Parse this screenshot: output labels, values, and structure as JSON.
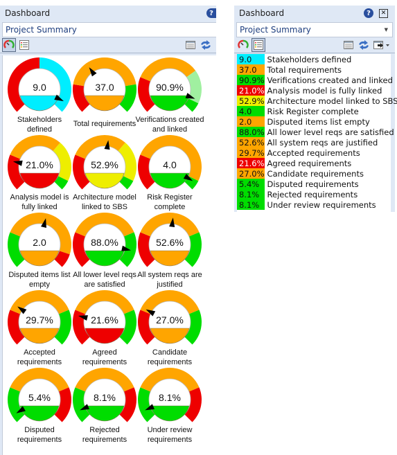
{
  "palette": {
    "red": "#ee0000",
    "orange": "#ffa500",
    "green": "#00dd00",
    "yellow": "#eeee00",
    "cyan": "#00eeff",
    "light_green": "#a0f0a0"
  },
  "left_panel": {
    "title": "Dashboard",
    "help_icon": "?",
    "view_selector": "Project Summary",
    "gauges": [
      {
        "value": 9.0,
        "display": "9.0",
        "label": "Stakeholders defined",
        "needle_fraction": 0.93,
        "fill_color": "cyan",
        "bands": [
          {
            "color": "red",
            "from": 0,
            "to": 0.5
          },
          {
            "color": "cyan",
            "from": 0.5,
            "to": 1
          }
        ]
      },
      {
        "value": 37.0,
        "display": "37.0",
        "label": "Total requirements",
        "needle_fraction": 0.37,
        "fill_color": "orange",
        "bands": [
          {
            "color": "red",
            "from": 0,
            "to": 0.2
          },
          {
            "color": "orange",
            "from": 0.2,
            "to": 0.8
          },
          {
            "color": "green",
            "from": 0.8,
            "to": 1
          }
        ]
      },
      {
        "value": 90.9,
        "display": "90.9%",
        "label": "Verifications created and linked",
        "needle_fraction": 0.909,
        "fill_color": "green",
        "bands": [
          {
            "color": "red",
            "from": 0,
            "to": 0.25
          },
          {
            "color": "orange",
            "from": 0.25,
            "to": 0.7
          },
          {
            "color": "light_green",
            "from": 0.7,
            "to": 0.93
          },
          {
            "color": "green",
            "from": 0.93,
            "to": 1
          }
        ]
      },
      {
        "value": 21.0,
        "display": "21.0%",
        "label": "Analysis model is fully linked",
        "needle_fraction": 0.21,
        "fill_color": "red",
        "bands": [
          {
            "color": "red",
            "from": 0,
            "to": 0.25
          },
          {
            "color": "orange",
            "from": 0.25,
            "to": 0.65
          },
          {
            "color": "yellow",
            "from": 0.65,
            "to": 0.93
          },
          {
            "color": "green",
            "from": 0.93,
            "to": 1
          }
        ]
      },
      {
        "value": 52.9,
        "display": "52.9%",
        "label": "Architecture model linked to SBS",
        "needle_fraction": 0.529,
        "fill_color": "yellow",
        "bands": [
          {
            "color": "red",
            "from": 0,
            "to": 0.25
          },
          {
            "color": "orange",
            "from": 0.25,
            "to": 0.65
          },
          {
            "color": "yellow",
            "from": 0.65,
            "to": 0.93
          },
          {
            "color": "green",
            "from": 0.93,
            "to": 1
          }
        ]
      },
      {
        "value": 4.0,
        "display": "4.0",
        "label": "Risk Register complete",
        "needle_fraction": 0.95,
        "fill_color": "green",
        "bands": [
          {
            "color": "red",
            "from": 0,
            "to": 0.25
          },
          {
            "color": "orange",
            "from": 0.25,
            "to": 0.93
          },
          {
            "color": "green",
            "from": 0.93,
            "to": 1
          }
        ]
      },
      {
        "value": 2.0,
        "display": "2.0",
        "label": "Disputed items list empty",
        "needle_fraction": 0.55,
        "fill_color": "orange",
        "bands": [
          {
            "color": "green",
            "from": 0,
            "to": 0.25
          },
          {
            "color": "orange",
            "from": 0.25,
            "to": 0.9
          },
          {
            "color": "red",
            "from": 0.9,
            "to": 1
          }
        ]
      },
      {
        "value": 88.0,
        "display": "88.0%",
        "label": "All lower level reqs are satisfied",
        "needle_fraction": 0.88,
        "fill_color": "green",
        "bands": [
          {
            "color": "red",
            "from": 0,
            "to": 0.25
          },
          {
            "color": "orange",
            "from": 0.25,
            "to": 0.75
          },
          {
            "color": "green",
            "from": 0.75,
            "to": 1
          }
        ]
      },
      {
        "value": 52.6,
        "display": "52.6%",
        "label": "All system reqs are justified",
        "needle_fraction": 0.526,
        "fill_color": "orange",
        "bands": [
          {
            "color": "red",
            "from": 0,
            "to": 0.25
          },
          {
            "color": "orange",
            "from": 0.25,
            "to": 0.75
          },
          {
            "color": "green",
            "from": 0.75,
            "to": 1
          }
        ]
      },
      {
        "value": 29.7,
        "display": "29.7%",
        "label": "Accepted requirements",
        "needle_fraction": 0.297,
        "fill_color": "orange",
        "bands": [
          {
            "color": "red",
            "from": 0,
            "to": 0.25
          },
          {
            "color": "orange",
            "from": 0.25,
            "to": 0.75
          },
          {
            "color": "green",
            "from": 0.75,
            "to": 1
          }
        ]
      },
      {
        "value": 21.6,
        "display": "21.6%",
        "label": "Agreed requirements",
        "needle_fraction": 0.216,
        "fill_color": "red",
        "bands": [
          {
            "color": "red",
            "from": 0,
            "to": 0.25
          },
          {
            "color": "orange",
            "from": 0.25,
            "to": 0.75
          },
          {
            "color": "green",
            "from": 0.75,
            "to": 1
          }
        ]
      },
      {
        "value": 27.0,
        "display": "27.0%",
        "label": "Candidate requirements",
        "needle_fraction": 0.27,
        "fill_color": "orange",
        "bands": [
          {
            "color": "red",
            "from": 0,
            "to": 0.25
          },
          {
            "color": "orange",
            "from": 0.25,
            "to": 0.75
          },
          {
            "color": "green",
            "from": 0.75,
            "to": 1
          }
        ]
      },
      {
        "value": 5.4,
        "display": "5.4%",
        "label": "Disputed requirements",
        "needle_fraction": 0.054,
        "fill_color": "green",
        "bands": [
          {
            "color": "green",
            "from": 0,
            "to": 0.25
          },
          {
            "color": "orange",
            "from": 0.25,
            "to": 0.75
          },
          {
            "color": "red",
            "from": 0.75,
            "to": 1
          }
        ]
      },
      {
        "value": 8.1,
        "display": "8.1%",
        "label": "Rejected requirements",
        "needle_fraction": 0.081,
        "fill_color": "green",
        "bands": [
          {
            "color": "green",
            "from": 0,
            "to": 0.25
          },
          {
            "color": "orange",
            "from": 0.25,
            "to": 0.75
          },
          {
            "color": "red",
            "from": 0.75,
            "to": 1
          }
        ]
      },
      {
        "value": 8.1,
        "display": "8.1%",
        "label": "Under review requirements",
        "needle_fraction": 0.081,
        "fill_color": "green",
        "bands": [
          {
            "color": "green",
            "from": 0,
            "to": 0.25
          },
          {
            "color": "orange",
            "from": 0.25,
            "to": 0.75
          },
          {
            "color": "red",
            "from": 0.75,
            "to": 1
          }
        ]
      }
    ]
  },
  "right_panel": {
    "title": "Dashboard",
    "help_icon": "?",
    "close_icon": "✕",
    "view_selector": "Project Summary",
    "rows": [
      {
        "value": "9.0",
        "label": "Stakeholders defined",
        "color": "cyan"
      },
      {
        "value": "37.0",
        "label": "Total requirements",
        "color": "orange"
      },
      {
        "value": "90.9%",
        "label": "Verifications created and linked",
        "color": "green"
      },
      {
        "value": "21.0%",
        "label": "Analysis model is fully linked",
        "color": "red"
      },
      {
        "value": "52.9%",
        "label": "Architecture model linked to SBS",
        "color": "yellow"
      },
      {
        "value": "4.0",
        "label": "Risk Register complete",
        "color": "green"
      },
      {
        "value": "2.0",
        "label": "Disputed items list empty",
        "color": "orange"
      },
      {
        "value": "88.0%",
        "label": "All lower level reqs are satisfied",
        "color": "green"
      },
      {
        "value": "52.6%",
        "label": "All system reqs are justified",
        "color": "orange"
      },
      {
        "value": "29.7%",
        "label": "Accepted requirements",
        "color": "orange"
      },
      {
        "value": "21.6%",
        "label": "Agreed requirements",
        "color": "red"
      },
      {
        "value": "27.0%",
        "label": "Candidate requirements",
        "color": "orange"
      },
      {
        "value": "5.4%",
        "label": "Disputed requirements",
        "color": "green"
      },
      {
        "value": "8.1%",
        "label": "Rejected requirements",
        "color": "green"
      },
      {
        "value": "8.1%",
        "label": "Under review requirements",
        "color": "green"
      }
    ]
  }
}
